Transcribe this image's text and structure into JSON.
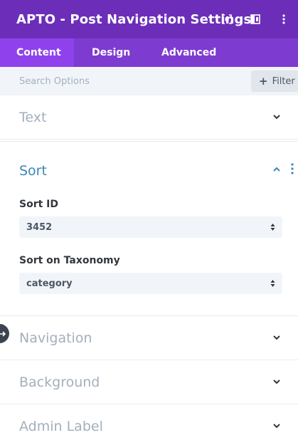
{
  "header": {
    "title": "APTO - Post Navigation Settings",
    "icons": [
      "expand-icon",
      "split-view-icon",
      "more-vertical-icon"
    ]
  },
  "tabs": [
    {
      "label": "Content",
      "active": true
    },
    {
      "label": "Design",
      "active": false
    },
    {
      "label": "Advanced",
      "active": false
    }
  ],
  "search": {
    "placeholder": "Search Options",
    "filter_label": "Filter"
  },
  "sections": {
    "text": {
      "title": "Text"
    },
    "sort": {
      "title": "Sort",
      "fields": [
        {
          "label": "Sort ID",
          "value": "3452"
        },
        {
          "label": "Sort on Taxonomy",
          "value": "category"
        }
      ]
    },
    "navigation": {
      "title": "Navigation"
    },
    "background": {
      "title": "Background"
    },
    "admin_label": {
      "title": "Admin Label"
    }
  },
  "colors": {
    "header_bg": "#6c2eb9",
    "tabs_bg": "#7e3bd0",
    "active_tab_bg": "#8f42ec",
    "open_section_title": "#3c87b4"
  }
}
